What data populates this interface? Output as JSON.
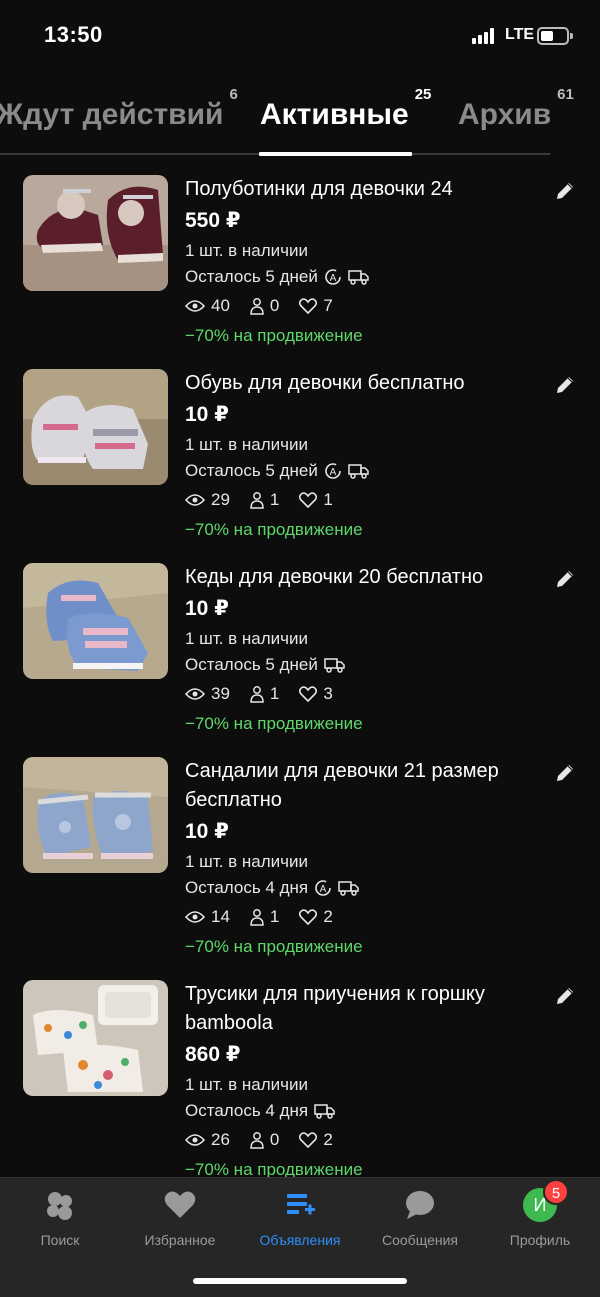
{
  "status_bar": {
    "time": "13:50",
    "network": "LTE",
    "battery_icon": "battery-icon",
    "signal_icon": "signal-icon"
  },
  "tabs": [
    {
      "label": "Ждут действий",
      "count": "6",
      "active": false
    },
    {
      "label": "Активные",
      "count": "25",
      "active": true
    },
    {
      "label": "Архив",
      "count": "61",
      "active": false
    }
  ],
  "listings": [
    {
      "title": "Полуботинки для девочки 24",
      "price": "550 ₽",
      "stock": "1 шт. в наличии",
      "remaining": "Осталось 5 дней",
      "autorenew": true,
      "delivery": true,
      "views": "40",
      "contacts": "0",
      "favorites": "7",
      "promo": "−70% на продвижение"
    },
    {
      "title": "Обувь для девочки бесплатно",
      "price": "10 ₽",
      "stock": "1 шт. в наличии",
      "remaining": "Осталось 5 дней",
      "autorenew": true,
      "delivery": true,
      "views": "29",
      "contacts": "1",
      "favorites": "1",
      "promo": "−70% на продвижение"
    },
    {
      "title": "Кеды для девочки 20 бесплатно",
      "price": "10 ₽",
      "stock": "1 шт. в наличии",
      "remaining": "Осталось 5 дней",
      "autorenew": false,
      "delivery": true,
      "views": "39",
      "contacts": "1",
      "favorites": "3",
      "promo": "−70% на продвижение"
    },
    {
      "title": "Сандалии для девочки 21 размер бесплатно",
      "price": "10 ₽",
      "stock": "1 шт. в наличии",
      "remaining": "Осталось 4 дня",
      "autorenew": true,
      "delivery": true,
      "views": "14",
      "contacts": "1",
      "favorites": "2",
      "promo": "−70% на продвижение"
    },
    {
      "title": "Трусики для приучения к горшку bamboola",
      "price": "860 ₽",
      "stock": "1 шт. в наличии",
      "remaining": "Осталось 4 дня",
      "autorenew": false,
      "delivery": true,
      "views": "26",
      "contacts": "0",
      "favorites": "2",
      "promo": "−70% на продвижение"
    }
  ],
  "bottom_nav": [
    {
      "label": "Поиск",
      "icon": "search-icon",
      "active": false
    },
    {
      "label": "Избранное",
      "icon": "heart-icon",
      "active": false
    },
    {
      "label": "Объявления",
      "icon": "listings-add-icon",
      "active": true
    },
    {
      "label": "Сообщения",
      "icon": "chat-icon",
      "active": false
    },
    {
      "label": "Профиль",
      "icon": "avatar",
      "active": false,
      "avatar_letter": "И",
      "badge": "5"
    }
  ],
  "colors": {
    "background": "#0d0d0d",
    "promo_green": "#5fd86b",
    "active_blue": "#2f8ef8",
    "badge_red": "#ff4040",
    "avatar_green": "#3fb84f"
  }
}
